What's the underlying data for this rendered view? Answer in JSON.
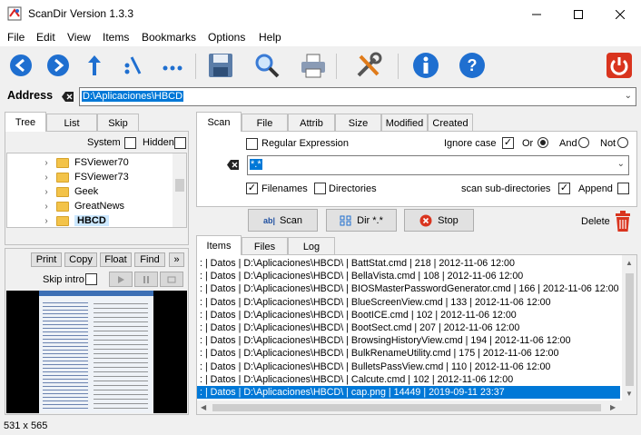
{
  "window": {
    "title": "ScanDir Version 1.3.3"
  },
  "menu": [
    "File",
    "Edit",
    "View",
    "Items",
    "Bookmarks",
    "Options",
    "Help"
  ],
  "toolbar": {
    "back": "back-arrow-icon",
    "forward": "forward-arrow-icon",
    "up": "up-arrow-icon",
    "path": "path-icon",
    "more": "more-icon",
    "save": "save-icon",
    "search": "search-icon",
    "print": "print-icon",
    "tools": "tools-icon",
    "info": "info-icon",
    "help": "help-icon",
    "exit": "power-icon"
  },
  "address": {
    "label": "Address",
    "value": "D:\\Aplicaciones\\HBCD"
  },
  "left_tabs": [
    "Tree",
    "List",
    "Skip"
  ],
  "tree_options": {
    "system": "System",
    "hidden": "Hidden"
  },
  "tree_items": [
    "FSViewer70",
    "FSViewer73",
    "Geek",
    "GreatNews",
    "HBCD"
  ],
  "tree_selected": "HBCD",
  "preview": {
    "buttons": [
      "Print",
      "Copy",
      "Float",
      "Find"
    ],
    "skip_intro": "Skip intro"
  },
  "status": {
    "dimensions": "531 x 565"
  },
  "scan_tabs": [
    "Scan",
    "File",
    "Attrib",
    "Size",
    "Modified",
    "Created"
  ],
  "scan": {
    "regex": "Regular Expression",
    "ignore_case": "Ignore case",
    "or": "Or",
    "and": "And",
    "not": "Not",
    "pattern": "*.*",
    "filenames": "Filenames",
    "directories": "Directories",
    "subdirs": "scan sub-directories",
    "append": "Append",
    "scan_btn": "Scan",
    "dir_btn": "Dir *.*",
    "stop_btn": "Stop",
    "delete": "Delete"
  },
  "result_tabs": [
    "Items",
    "Files",
    "Log"
  ],
  "results": [
    ": | Datos | D:\\Aplicaciones\\HBCD\\ | BattStat.cmd | 218 | 2012-11-06 12:00",
    ": | Datos | D:\\Aplicaciones\\HBCD\\ | BellaVista.cmd | 108 | 2012-11-06 12:00",
    ": | Datos | D:\\Aplicaciones\\HBCD\\ | BIOSMasterPasswordGenerator.cmd | 166 | 2012-11-06 12:00",
    ": | Datos | D:\\Aplicaciones\\HBCD\\ | BlueScreenView.cmd | 133 | 2012-11-06 12:00",
    ": | Datos | D:\\Aplicaciones\\HBCD\\ | BootICE.cmd | 102 | 2012-11-06 12:00",
    ": | Datos | D:\\Aplicaciones\\HBCD\\ | BootSect.cmd | 207 | 2012-11-06 12:00",
    ": | Datos | D:\\Aplicaciones\\HBCD\\ | BrowsingHistoryView.cmd | 194 | 2012-11-06 12:00",
    ": | Datos | D:\\Aplicaciones\\HBCD\\ | BulkRenameUtility.cmd | 175 | 2012-11-06 12:00",
    ": | Datos | D:\\Aplicaciones\\HBCD\\ | BulletsPassView.cmd | 110 | 2012-11-06 12:00",
    ": | Datos | D:\\Aplicaciones\\HBCD\\ | Calcute.cmd | 102 | 2012-11-06 12:00",
    ": | Datos | D:\\Aplicaciones\\HBCD\\ | cap.png | 14449 | 2019-09-11 23:37"
  ],
  "selected_result": 10
}
